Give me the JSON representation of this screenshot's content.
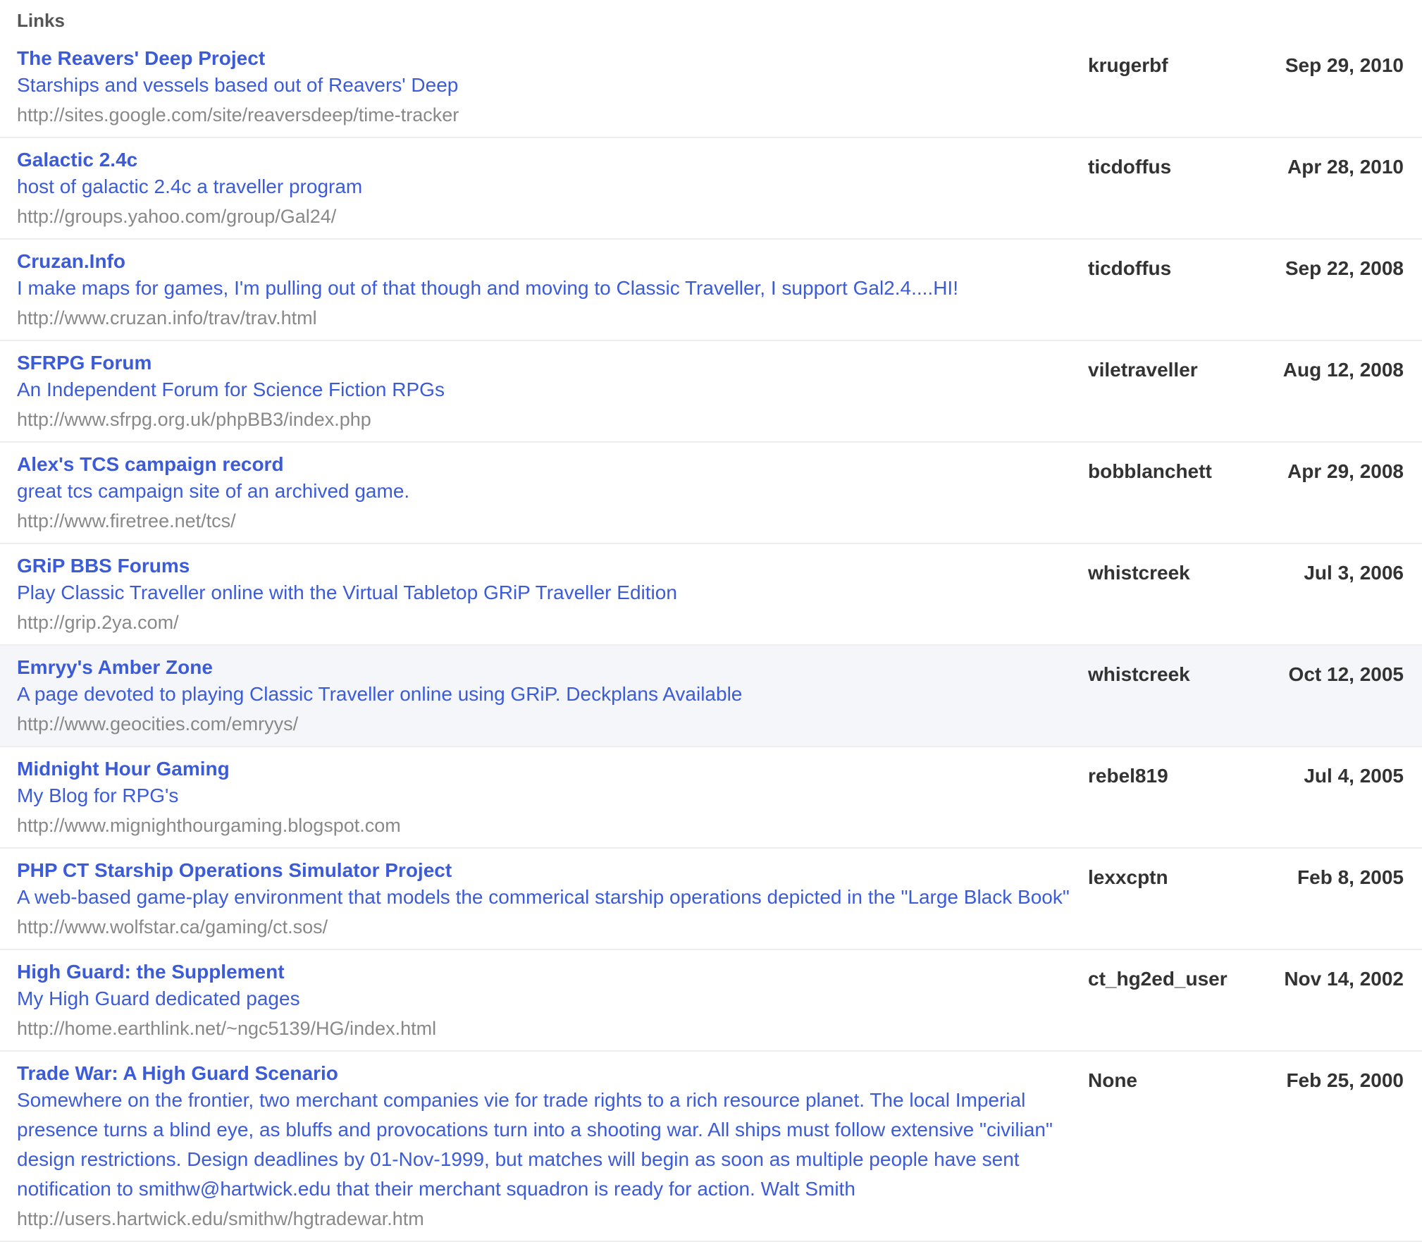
{
  "heading": "Links",
  "rows": [
    {
      "title": "The Reavers' Deep Project",
      "desc": "Starships and vessels based out of Reavers' Deep",
      "url": "http://sites.google.com/site/reaversdeep/time-tracker",
      "user": "krugerbf",
      "date": "Sep 29, 2010",
      "highlighted": false
    },
    {
      "title": "Galactic 2.4c",
      "desc": "host of galactic 2.4c a traveller program",
      "url": "http://groups.yahoo.com/group/Gal24/",
      "user": "ticdoffus",
      "date": "Apr 28, 2010",
      "highlighted": false
    },
    {
      "title": "Cruzan.Info",
      "desc": "I make maps for games, I'm pulling out of that though and moving to Classic Traveller, I support Gal2.4....HI!",
      "url": "http://www.cruzan.info/trav/trav.html",
      "user": "ticdoffus",
      "date": "Sep 22, 2008",
      "highlighted": false
    },
    {
      "title": "SFRPG Forum",
      "desc": "An Independent Forum for Science Fiction RPGs",
      "url": "http://www.sfrpg.org.uk/phpBB3/index.php",
      "user": "viletraveller",
      "date": "Aug 12, 2008",
      "highlighted": false
    },
    {
      "title": "Alex's TCS campaign record",
      "desc": "great tcs campaign site of an archived game.",
      "url": "http://www.firetree.net/tcs/",
      "user": "bobblanchett",
      "date": "Apr 29, 2008",
      "highlighted": false
    },
    {
      "title": "GRiP BBS Forums",
      "desc": "Play Classic Traveller online with the Virtual Tabletop GRiP Traveller Edition",
      "url": "http://grip.2ya.com/",
      "user": "whistcreek",
      "date": "Jul 3, 2006",
      "highlighted": false
    },
    {
      "title": "Emryy's Amber Zone",
      "desc": "A page devoted to playing Classic Traveller online using GRiP. Deckplans Available",
      "url": "http://www.geocities.com/emryys/",
      "user": "whistcreek",
      "date": "Oct 12, 2005",
      "highlighted": true
    },
    {
      "title": "Midnight Hour Gaming",
      "desc": "My Blog for RPG's",
      "url": "http://www.mignighthourgaming.blogspot.com",
      "user": "rebel819",
      "date": "Jul 4, 2005",
      "highlighted": false
    },
    {
      "title": "PHP CT Starship Operations Simulator Project",
      "desc": "A web-based game-play environment that models the commerical starship operations depicted in the \"Large Black Book\"",
      "url": "http://www.wolfstar.ca/gaming/ct.sos/",
      "user": "lexxcptn",
      "date": "Feb 8, 2005",
      "highlighted": false
    },
    {
      "title": "High Guard: the Supplement",
      "desc": "My High Guard dedicated pages",
      "url": "http://home.earthlink.net/~ngc5139/HG/index.html",
      "user": "ct_hg2ed_user",
      "date": "Nov 14, 2002",
      "highlighted": false
    },
    {
      "title": "Trade War: A High Guard Scenario",
      "desc": "Somewhere on the frontier, two merchant companies vie for trade rights to a rich resource planet. The local Imperial presence turns a blind eye, as bluffs and provocations turn into a shooting war. All ships must follow extensive \"civilian\" design restrictions. Design deadlines by 01-Nov-1999, but matches will begin as soon as multiple people have sent notification to smithw@hartwick.edu that their merchant squadron is ready for action. Walt Smith",
      "url": "http://users.hartwick.edu/smithw/hgtradewar.htm",
      "user": "None",
      "date": "Feb 25, 2000",
      "highlighted": false
    }
  ]
}
